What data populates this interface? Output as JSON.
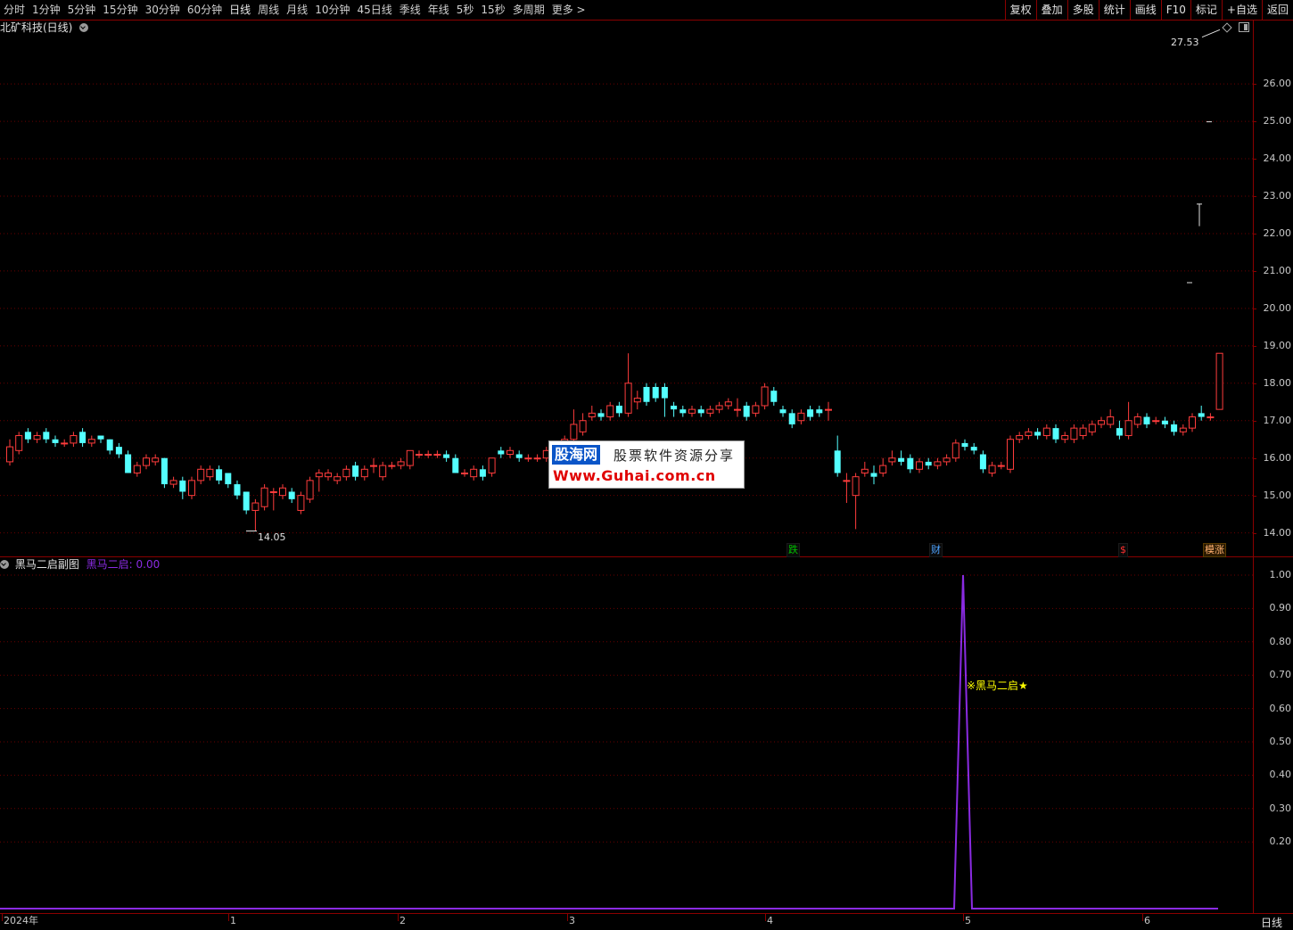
{
  "toolbar": {
    "periods": [
      "分时",
      "1分钟",
      "5分钟",
      "15分钟",
      "30分钟",
      "60分钟",
      "日线",
      "周线",
      "月线",
      "10分钟",
      "45日线",
      "季线",
      "年线",
      "5秒",
      "15秒",
      "多周期",
      "更多 >"
    ],
    "tools": [
      "复权",
      "叠加",
      "多股",
      "统计",
      "画线",
      "F10",
      "标记",
      "+自选",
      "返回"
    ]
  },
  "main_panel": {
    "title": "北矿科技(日线)",
    "high_label": "27.53",
    "low_label": "14.05",
    "y_ticks": [
      "26.00",
      "25.00",
      "24.00",
      "23.00",
      "22.00",
      "21.00",
      "20.00",
      "19.00",
      "18.00",
      "17.00",
      "16.00",
      "15.00",
      "14.00"
    ],
    "markers": [
      {
        "text": "跌",
        "color": "#00c000"
      },
      {
        "text": "财",
        "color": "#4da3ff"
      },
      {
        "text": "$",
        "color": "#ff3030"
      },
      {
        "text": "模涨",
        "color": "#ffb070"
      }
    ]
  },
  "sub_panel": {
    "title": "黑马二启副图",
    "indicator_name": "黑马二启:",
    "indicator_value": "0.00",
    "signal_text": "※黑马二启★",
    "y_ticks": [
      "1.00",
      "0.90",
      "0.80",
      "0.70",
      "0.60",
      "0.50",
      "0.40",
      "0.30",
      "0.20"
    ]
  },
  "x_axis": {
    "labels": [
      "2024年",
      "1",
      "2",
      "3",
      "4",
      "5",
      "6"
    ]
  },
  "period_label": "日线",
  "watermark": {
    "logo": "股海网",
    "slogan": "股票软件资源分享",
    "url": "Www.Guhai.com.cn"
  },
  "colors": {
    "up": "#ff3c3c",
    "down": "#54ffff",
    "grid": "#7a0000",
    "indicator": "#8a2be2",
    "signal": "#ffff00"
  },
  "chart_data": {
    "type": "candlestick",
    "title": "北矿科技(日线)",
    "ylim": [
      13.8,
      27.6
    ],
    "candles": [
      {
        "o": 15.9,
        "c": 16.3,
        "h": 16.5,
        "l": 15.8
      },
      {
        "o": 16.2,
        "c": 16.6,
        "h": 16.7,
        "l": 16.1
      },
      {
        "o": 16.7,
        "c": 16.5,
        "h": 16.8,
        "l": 16.4
      },
      {
        "o": 16.5,
        "c": 16.6,
        "h": 16.7,
        "l": 16.4
      },
      {
        "o": 16.7,
        "c": 16.5,
        "h": 16.8,
        "l": 16.4
      },
      {
        "o": 16.5,
        "c": 16.4,
        "h": 16.6,
        "l": 16.3
      },
      {
        "o": 16.4,
        "c": 16.4,
        "h": 16.5,
        "l": 16.3
      },
      {
        "o": 16.4,
        "c": 16.6,
        "h": 16.7,
        "l": 16.3
      },
      {
        "o": 16.7,
        "c": 16.4,
        "h": 16.8,
        "l": 16.3
      },
      {
        "o": 16.4,
        "c": 16.5,
        "h": 16.6,
        "l": 16.3
      },
      {
        "o": 16.6,
        "c": 16.5,
        "h": 16.6,
        "l": 16.4
      },
      {
        "o": 16.5,
        "c": 16.2,
        "h": 16.5,
        "l": 16.1
      },
      {
        "o": 16.3,
        "c": 16.1,
        "h": 16.4,
        "l": 16.0
      },
      {
        "o": 16.1,
        "c": 15.6,
        "h": 16.2,
        "l": 15.6
      },
      {
        "o": 15.6,
        "c": 15.8,
        "h": 15.9,
        "l": 15.5
      },
      {
        "o": 15.8,
        "c": 16.0,
        "h": 16.1,
        "l": 15.7
      },
      {
        "o": 15.9,
        "c": 16.0,
        "h": 16.1,
        "l": 15.8
      },
      {
        "o": 16.0,
        "c": 15.3,
        "h": 16.0,
        "l": 15.2
      },
      {
        "o": 15.3,
        "c": 15.4,
        "h": 15.5,
        "l": 15.2
      },
      {
        "o": 15.4,
        "c": 15.1,
        "h": 15.5,
        "l": 14.9
      },
      {
        "o": 15.0,
        "c": 15.4,
        "h": 15.5,
        "l": 14.9
      },
      {
        "o": 15.4,
        "c": 15.7,
        "h": 15.8,
        "l": 15.3
      },
      {
        "o": 15.5,
        "c": 15.7,
        "h": 15.8,
        "l": 15.4
      },
      {
        "o": 15.7,
        "c": 15.4,
        "h": 15.8,
        "l": 15.3
      },
      {
        "o": 15.6,
        "c": 15.3,
        "h": 15.6,
        "l": 15.2
      },
      {
        "o": 15.3,
        "c": 15.0,
        "h": 15.4,
        "l": 14.9
      },
      {
        "o": 15.1,
        "c": 14.6,
        "h": 15.1,
        "l": 14.5
      },
      {
        "o": 14.6,
        "c": 14.8,
        "h": 14.9,
        "l": 14.05
      },
      {
        "o": 14.7,
        "c": 15.2,
        "h": 15.3,
        "l": 14.6
      },
      {
        "o": 15.1,
        "c": 15.1,
        "h": 15.2,
        "l": 14.6
      },
      {
        "o": 15.0,
        "c": 15.2,
        "h": 15.3,
        "l": 14.9
      },
      {
        "o": 15.1,
        "c": 14.9,
        "h": 15.2,
        "l": 14.8
      },
      {
        "o": 14.6,
        "c": 15.0,
        "h": 15.1,
        "l": 14.5
      },
      {
        "o": 14.9,
        "c": 15.4,
        "h": 15.5,
        "l": 14.8
      },
      {
        "o": 15.5,
        "c": 15.6,
        "h": 15.7,
        "l": 15.1
      },
      {
        "o": 15.5,
        "c": 15.6,
        "h": 15.7,
        "l": 15.4
      },
      {
        "o": 15.4,
        "c": 15.5,
        "h": 15.6,
        "l": 15.3
      },
      {
        "o": 15.5,
        "c": 15.7,
        "h": 15.8,
        "l": 15.4
      },
      {
        "o": 15.8,
        "c": 15.5,
        "h": 15.9,
        "l": 15.4
      },
      {
        "o": 15.5,
        "c": 15.7,
        "h": 15.8,
        "l": 15.4
      },
      {
        "o": 15.8,
        "c": 15.8,
        "h": 16.0,
        "l": 15.6
      },
      {
        "o": 15.5,
        "c": 15.8,
        "h": 15.9,
        "l": 15.4
      },
      {
        "o": 15.8,
        "c": 15.8,
        "h": 15.9,
        "l": 15.7
      },
      {
        "o": 15.8,
        "c": 15.9,
        "h": 16.0,
        "l": 15.7
      },
      {
        "o": 15.8,
        "c": 16.2,
        "h": 16.2,
        "l": 15.7
      },
      {
        "o": 16.1,
        "c": 16.1,
        "h": 16.2,
        "l": 16.0
      },
      {
        "o": 16.1,
        "c": 16.1,
        "h": 16.2,
        "l": 16.0
      },
      {
        "o": 16.1,
        "c": 16.1,
        "h": 16.2,
        "l": 16.0
      },
      {
        "o": 16.1,
        "c": 16.0,
        "h": 16.2,
        "l": 15.9
      },
      {
        "o": 16.0,
        "c": 15.6,
        "h": 16.1,
        "l": 15.6
      },
      {
        "o": 15.6,
        "c": 15.6,
        "h": 15.7,
        "l": 15.5
      },
      {
        "o": 15.5,
        "c": 15.7,
        "h": 15.8,
        "l": 15.4
      },
      {
        "o": 15.7,
        "c": 15.5,
        "h": 15.8,
        "l": 15.4
      },
      {
        "o": 15.6,
        "c": 16.0,
        "h": 16.0,
        "l": 15.5
      },
      {
        "o": 16.2,
        "c": 16.1,
        "h": 16.3,
        "l": 16.0
      },
      {
        "o": 16.1,
        "c": 16.2,
        "h": 16.3,
        "l": 16.0
      },
      {
        "o": 16.1,
        "c": 16.0,
        "h": 16.2,
        "l": 15.9
      },
      {
        "o": 16.0,
        "c": 16.0,
        "h": 16.1,
        "l": 15.9
      },
      {
        "o": 16.0,
        "c": 16.0,
        "h": 16.1,
        "l": 15.9
      },
      {
        "o": 16.0,
        "c": 16.2,
        "h": 16.3,
        "l": 15.9
      },
      {
        "o": 16.2,
        "c": 16.3,
        "h": 16.4,
        "l": 16.1
      },
      {
        "o": 16.3,
        "c": 16.5,
        "h": 16.6,
        "l": 16.2
      },
      {
        "o": 16.5,
        "c": 16.9,
        "h": 17.3,
        "l": 16.4
      },
      {
        "o": 16.7,
        "c": 17.0,
        "h": 17.2,
        "l": 16.6
      },
      {
        "o": 17.1,
        "c": 17.2,
        "h": 17.4,
        "l": 17.0
      },
      {
        "o": 17.2,
        "c": 17.1,
        "h": 17.3,
        "l": 17.0
      },
      {
        "o": 17.1,
        "c": 17.4,
        "h": 17.5,
        "l": 17.0
      },
      {
        "o": 17.4,
        "c": 17.2,
        "h": 17.5,
        "l": 17.1
      },
      {
        "o": 17.2,
        "c": 18.0,
        "h": 18.8,
        "l": 17.1
      },
      {
        "o": 17.5,
        "c": 17.6,
        "h": 17.8,
        "l": 17.3
      },
      {
        "o": 17.9,
        "c": 17.5,
        "h": 18.0,
        "l": 17.4
      },
      {
        "o": 17.9,
        "c": 17.6,
        "h": 18.0,
        "l": 17.5
      },
      {
        "o": 17.9,
        "c": 17.6,
        "h": 18.0,
        "l": 17.1
      },
      {
        "o": 17.4,
        "c": 17.3,
        "h": 17.5,
        "l": 17.1
      },
      {
        "o": 17.3,
        "c": 17.2,
        "h": 17.4,
        "l": 17.1
      },
      {
        "o": 17.2,
        "c": 17.3,
        "h": 17.4,
        "l": 17.1
      },
      {
        "o": 17.3,
        "c": 17.2,
        "h": 17.4,
        "l": 17.1
      },
      {
        "o": 17.2,
        "c": 17.3,
        "h": 17.4,
        "l": 17.1
      },
      {
        "o": 17.3,
        "c": 17.4,
        "h": 17.5,
        "l": 17.2
      },
      {
        "o": 17.4,
        "c": 17.5,
        "h": 17.6,
        "l": 17.3
      },
      {
        "o": 17.3,
        "c": 17.3,
        "h": 17.6,
        "l": 17.1
      },
      {
        "o": 17.4,
        "c": 17.1,
        "h": 17.5,
        "l": 17.0
      },
      {
        "o": 17.2,
        "c": 17.4,
        "h": 17.5,
        "l": 17.1
      },
      {
        "o": 17.4,
        "c": 17.9,
        "h": 18.0,
        "l": 17.3
      },
      {
        "o": 17.8,
        "c": 17.5,
        "h": 17.9,
        "l": 17.4
      },
      {
        "o": 17.3,
        "c": 17.2,
        "h": 17.4,
        "l": 17.1
      },
      {
        "o": 17.2,
        "c": 16.9,
        "h": 17.3,
        "l": 16.8
      },
      {
        "o": 17.0,
        "c": 17.2,
        "h": 17.3,
        "l": 16.9
      },
      {
        "o": 17.3,
        "c": 17.1,
        "h": 17.4,
        "l": 17.0
      },
      {
        "o": 17.3,
        "c": 17.2,
        "h": 17.4,
        "l": 17.1
      },
      {
        "o": 17.3,
        "c": 17.3,
        "h": 17.5,
        "l": 17.0
      },
      {
        "o": 16.2,
        "c": 15.6,
        "h": 16.6,
        "l": 15.5
      },
      {
        "o": 15.4,
        "c": 15.4,
        "h": 15.6,
        "l": 14.8
      },
      {
        "o": 15.0,
        "c": 15.5,
        "h": 15.6,
        "l": 14.1
      },
      {
        "o": 15.6,
        "c": 15.7,
        "h": 15.9,
        "l": 15.5
      },
      {
        "o": 15.6,
        "c": 15.5,
        "h": 15.8,
        "l": 15.3
      },
      {
        "o": 15.6,
        "c": 15.8,
        "h": 16.0,
        "l": 15.5
      },
      {
        "o": 15.9,
        "c": 16.0,
        "h": 16.2,
        "l": 15.8
      },
      {
        "o": 16.0,
        "c": 15.9,
        "h": 16.2,
        "l": 15.8
      },
      {
        "o": 16.0,
        "c": 15.7,
        "h": 16.1,
        "l": 15.6
      },
      {
        "o": 15.7,
        "c": 15.9,
        "h": 16.0,
        "l": 15.6
      },
      {
        "o": 15.9,
        "c": 15.8,
        "h": 16.0,
        "l": 15.7
      },
      {
        "o": 15.8,
        "c": 15.9,
        "h": 16.0,
        "l": 15.7
      },
      {
        "o": 15.9,
        "c": 16.0,
        "h": 16.1,
        "l": 15.8
      },
      {
        "o": 16.0,
        "c": 16.4,
        "h": 16.5,
        "l": 15.9
      },
      {
        "o": 16.4,
        "c": 16.3,
        "h": 16.5,
        "l": 16.2
      },
      {
        "o": 16.3,
        "c": 16.2,
        "h": 16.4,
        "l": 16.1
      },
      {
        "o": 16.1,
        "c": 15.7,
        "h": 16.2,
        "l": 15.6
      },
      {
        "o": 15.6,
        "c": 15.8,
        "h": 15.9,
        "l": 15.5
      },
      {
        "o": 15.8,
        "c": 15.8,
        "h": 15.9,
        "l": 15.7
      },
      {
        "o": 15.7,
        "c": 16.5,
        "h": 16.6,
        "l": 15.6
      },
      {
        "o": 16.5,
        "c": 16.6,
        "h": 16.7,
        "l": 16.4
      },
      {
        "o": 16.6,
        "c": 16.7,
        "h": 16.8,
        "l": 16.5
      },
      {
        "o": 16.7,
        "c": 16.6,
        "h": 16.8,
        "l": 16.5
      },
      {
        "o": 16.6,
        "c": 16.8,
        "h": 16.9,
        "l": 16.5
      },
      {
        "o": 16.8,
        "c": 16.5,
        "h": 16.9,
        "l": 16.4
      },
      {
        "o": 16.5,
        "c": 16.6,
        "h": 16.7,
        "l": 16.4
      },
      {
        "o": 16.5,
        "c": 16.8,
        "h": 16.9,
        "l": 16.4
      },
      {
        "o": 16.6,
        "c": 16.8,
        "h": 16.9,
        "l": 16.5
      },
      {
        "o": 16.7,
        "c": 16.9,
        "h": 17.0,
        "l": 16.6
      },
      {
        "o": 16.9,
        "c": 17.0,
        "h": 17.1,
        "l": 16.8
      },
      {
        "o": 16.9,
        "c": 17.1,
        "h": 17.3,
        "l": 16.8
      },
      {
        "o": 16.8,
        "c": 16.6,
        "h": 17.0,
        "l": 16.5
      },
      {
        "o": 16.6,
        "c": 17.0,
        "h": 17.5,
        "l": 16.5
      },
      {
        "o": 16.9,
        "c": 17.1,
        "h": 17.2,
        "l": 16.8
      },
      {
        "o": 17.1,
        "c": 16.9,
        "h": 17.2,
        "l": 16.8
      },
      {
        "o": 17.0,
        "c": 17.0,
        "h": 17.1,
        "l": 16.9
      },
      {
        "o": 17.0,
        "c": 16.9,
        "h": 17.1,
        "l": 16.8
      },
      {
        "o": 16.9,
        "c": 16.7,
        "h": 17.0,
        "l": 16.6
      },
      {
        "o": 16.7,
        "c": 16.8,
        "h": 16.9,
        "l": 16.6
      },
      {
        "o": 16.8,
        "c": 17.1,
        "h": 17.2,
        "l": 16.7
      },
      {
        "o": 17.2,
        "c": 17.1,
        "h": 17.4,
        "l": 17.0
      },
      {
        "o": 17.1,
        "c": 17.1,
        "h": 17.2,
        "l": 17.0
      },
      {
        "o": 17.3,
        "c": 18.8,
        "h": 18.8,
        "l": 17.3
      },
      {
        "o": 20.7,
        "c": 20.7,
        "h": 20.7,
        "l": 20.7
      },
      {
        "o": 22.2,
        "c": 22.8,
        "h": 22.8,
        "l": 22.2
      },
      {
        "o": 25.0,
        "c": 25.0,
        "h": 25.0,
        "l": 25.0
      }
    ],
    "indicator": {
      "name": "黑马二启",
      "ylim": [
        0,
        1.05
      ],
      "peak_index": 130,
      "values_description": "0 everywhere, 1.00 at one bar"
    }
  }
}
